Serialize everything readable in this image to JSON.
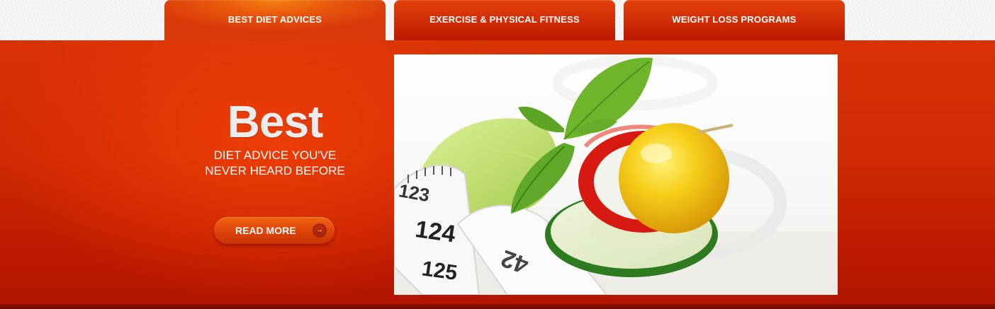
{
  "tabs": [
    {
      "label": "BEST DIET ADVICES",
      "active": true
    },
    {
      "label": "EXERCISE & PHYSICAL FITNESS",
      "active": false
    },
    {
      "label": "WEIGHT LOSS PROGRAMS",
      "active": false
    }
  ],
  "hero": {
    "title": "Best",
    "subtitle_line1": "DIET ADVICE YOU'VE",
    "subtitle_line2": "NEVER HEARD BEFORE",
    "button_label": "READ MORE",
    "button_icon": "arrow-right-icon"
  },
  "photo": {
    "tape_numbers": [
      "123",
      "124",
      "125",
      "42"
    ]
  },
  "colors": {
    "brand_red": "#cf2a04",
    "active_tab_orange": "#f5820e",
    "dark_bottom": "#7a0c00"
  }
}
